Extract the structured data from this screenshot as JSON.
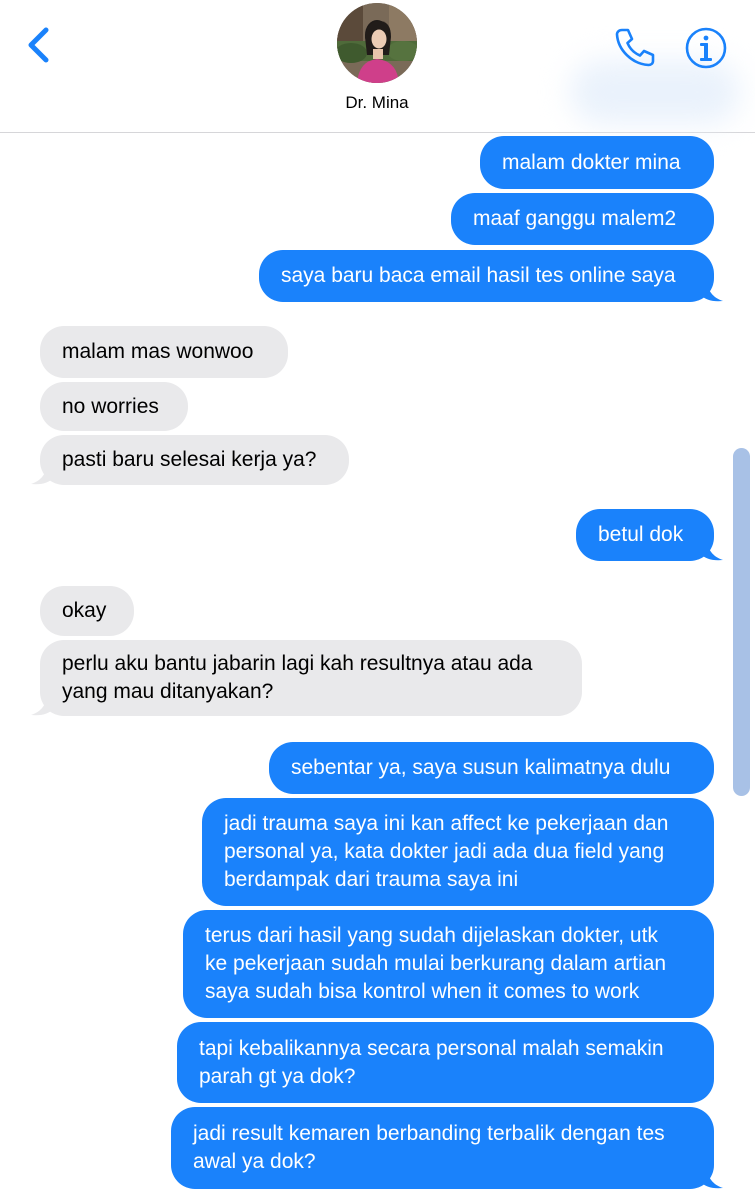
{
  "header": {
    "contact_name": "Dr. Mina",
    "accent_color": "#1a82fb"
  },
  "icons": {
    "back": "chevron-left-icon",
    "call": "phone-icon",
    "info": "info-icon"
  },
  "colors": {
    "sent_bubble": "#1a82fb",
    "received_bubble": "#e9e9eb"
  },
  "messages": [
    {
      "from": "me",
      "text": "malam dokter mina"
    },
    {
      "from": "me",
      "text": "maaf ganggu malem2"
    },
    {
      "from": "me",
      "text": "saya baru baca email hasil tes online saya"
    },
    {
      "from": "them",
      "text": "malam mas wonwoo"
    },
    {
      "from": "them",
      "text": "no worries"
    },
    {
      "from": "them",
      "text": "pasti baru selesai kerja ya?"
    },
    {
      "from": "me",
      "text": "betul dok"
    },
    {
      "from": "them",
      "text": "okay"
    },
    {
      "from": "them",
      "lines": [
        "perlu aku bantu jabarin lagi kah resultnya atau ada",
        "yang mau ditanyakan?"
      ]
    },
    {
      "from": "me",
      "text": "sebentar ya, saya susun kalimatnya dulu"
    },
    {
      "from": "me",
      "lines": [
        "jadi trauma saya ini kan affect ke pekerjaan dan",
        "personal ya, kata dokter jadi ada dua field yang",
        "berdampak dari trauma saya ini"
      ]
    },
    {
      "from": "me",
      "lines": [
        "terus dari hasil yang sudah dijelaskan dokter, utk",
        "ke pekerjaan sudah mulai berkurang dalam artian",
        "saya sudah bisa kontrol when it comes to work"
      ]
    },
    {
      "from": "me",
      "lines": [
        "tapi kebalikannya secara personal malah semakin",
        "parah gt ya dok?"
      ]
    },
    {
      "from": "me",
      "lines": [
        "jadi result kemaren berbanding terbalik dengan tes",
        "awal ya dok?"
      ]
    }
  ]
}
